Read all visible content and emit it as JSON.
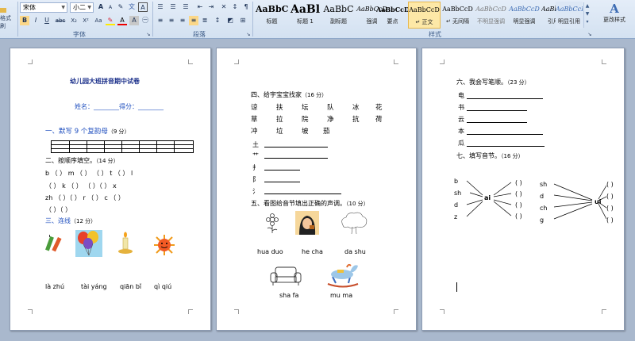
{
  "ribbon": {
    "format_painter": "格式刷",
    "font_name": "宋体",
    "font_size": "小二",
    "groups": {
      "font": "字体",
      "paragraph": "段落",
      "styles": "样式"
    },
    "font_buttons": [
      "B",
      "I",
      "U",
      "abc",
      "X₂",
      "X²",
      "Aa",
      "A",
      "A"
    ],
    "grow_font": "A",
    "shrink_font": "A",
    "styles": [
      {
        "sample": "AaBbC",
        "name": "标题"
      },
      {
        "sample": "AaBl",
        "name": "标题 1"
      },
      {
        "sample": "AaBbC",
        "name": "副标题"
      },
      {
        "sample": "AaBbCcD",
        "name": "强调"
      },
      {
        "sample": "AaBbCcD",
        "name": "要点"
      },
      {
        "sample": "AaBbCcD",
        "name": "↵ 正文"
      },
      {
        "sample": "AaBbCcD",
        "name": "↵ 无间隔"
      },
      {
        "sample": "AaBbCcD",
        "name": "不明显强调"
      },
      {
        "sample": "AaBbCcD",
        "name": "明显强调"
      },
      {
        "sample": "AaBbCcD",
        "name": "引用"
      },
      {
        "sample": "AaBbCcD",
        "name": "明显引用"
      }
    ],
    "change_styles": {
      "icon": "A",
      "label": "更改样式"
    }
  },
  "page1": {
    "title": "幼儿园大班拼音期中试卷",
    "name_score": "姓名：________得分：________",
    "s1": "一、默写 9 个复韵母",
    "s1_pts": "（9 分）",
    "s2": "二、按顺序填空。",
    "s2_pts": "（14 分）",
    "row1": "b （ ） m （ ）    （ ） t （ ） l",
    "row2": "（     ） k （  ）     （  ）（  ） x",
    "row3": "zh （  ）（  ） r     （   ）  c （  ）",
    "row4": "（  ）（  ）",
    "s3": "三、连线",
    "s3_pts": "（12 分）",
    "pinyin": [
      "là zhú",
      "tài yáng",
      "qiān bǐ",
      "qì qiú"
    ]
  },
  "page2": {
    "s4": "四、给宇宝宝找家",
    "s4_pts": "（16 分）",
    "chars1": [
      "谅",
      "扶",
      "坛",
      "队",
      "冰",
      "花"
    ],
    "chars2": [
      "草",
      "拉",
      "院",
      "净",
      "抗",
      "荷"
    ],
    "chars3": [
      "冲",
      "垃",
      "坡",
      "茄"
    ],
    "radicals": [
      "土",
      "艹",
      "扌",
      "阝",
      "氵"
    ],
    "s5": "五、看图给音节填出正确的声调。",
    "s5_pts": "（10 分）",
    "syl1": [
      "hua  duo",
      "he cha",
      "da shu"
    ],
    "syl2": [
      "sha fa",
      "mu ma"
    ]
  },
  "page3": {
    "s6": "六、我会写笔顺。",
    "s6_pts": "（23 分）",
    "chars": [
      "电",
      "书",
      "云",
      "本",
      "瓜"
    ],
    "s7": "七、填写音节。",
    "s7_pts": "（16 分）",
    "left_initials": [
      "b",
      "sh",
      "d",
      "z"
    ],
    "left_final": "ai",
    "right_initials": [
      "sh",
      "d",
      "ch",
      "g"
    ],
    "right_final": "ui"
  },
  "colors": {
    "ribbon_bg": "#dce7f5",
    "workspace": "#a9b8cd",
    "section_blue": "#1f4fbf"
  }
}
